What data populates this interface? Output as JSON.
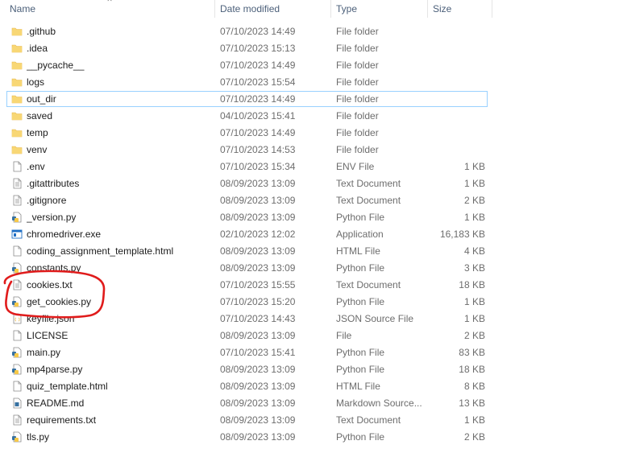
{
  "columns": {
    "name": "Name",
    "date": "Date modified",
    "type": "Type",
    "size": "Size"
  },
  "icon_colors": {
    "folder": "#f8d775",
    "folder_dark": "#e8b84a",
    "file_outline": "#8a8a8a",
    "python_blue": "#3771a1",
    "python_yellow": "#f7c948",
    "exe_blue": "#1f6fc5",
    "selection_border": "#99d1ff",
    "annotation_red": "#e01b1b"
  },
  "files": [
    {
      "name": ".github",
      "date": "07/10/2023 14:49",
      "type": "File folder",
      "size": "",
      "icon": "folder-icon"
    },
    {
      "name": ".idea",
      "date": "07/10/2023 15:13",
      "type": "File folder",
      "size": "",
      "icon": "folder-icon"
    },
    {
      "name": "__pycache__",
      "date": "07/10/2023 14:49",
      "type": "File folder",
      "size": "",
      "icon": "folder-icon"
    },
    {
      "name": "logs",
      "date": "07/10/2023 15:54",
      "type": "File folder",
      "size": "",
      "icon": "folder-icon"
    },
    {
      "name": "out_dir",
      "date": "07/10/2023 14:49",
      "type": "File folder",
      "size": "",
      "icon": "folder-icon",
      "selected": true
    },
    {
      "name": "saved",
      "date": "04/10/2023 15:41",
      "type": "File folder",
      "size": "",
      "icon": "folder-icon"
    },
    {
      "name": "temp",
      "date": "07/10/2023 14:49",
      "type": "File folder",
      "size": "",
      "icon": "folder-icon"
    },
    {
      "name": "venv",
      "date": "07/10/2023 14:53",
      "type": "File folder",
      "size": "",
      "icon": "folder-icon"
    },
    {
      "name": ".env",
      "date": "07/10/2023 15:34",
      "type": "ENV File",
      "size": "1 KB",
      "icon": "blank-file-icon"
    },
    {
      "name": ".gitattributes",
      "date": "08/09/2023 13:09",
      "type": "Text Document",
      "size": "1 KB",
      "icon": "text-file-icon"
    },
    {
      "name": ".gitignore",
      "date": "08/09/2023 13:09",
      "type": "Text Document",
      "size": "2 KB",
      "icon": "text-file-icon"
    },
    {
      "name": "_version.py",
      "date": "08/09/2023 13:09",
      "type": "Python File",
      "size": "1 KB",
      "icon": "python-file-icon"
    },
    {
      "name": "chromedriver.exe",
      "date": "02/10/2023 12:02",
      "type": "Application",
      "size": "16,183 KB",
      "icon": "application-icon"
    },
    {
      "name": "coding_assignment_template.html",
      "date": "08/09/2023 13:09",
      "type": "HTML File",
      "size": "4 KB",
      "icon": "blank-file-icon"
    },
    {
      "name": "constants.py",
      "date": "08/09/2023 13:09",
      "type": "Python File",
      "size": "3 KB",
      "icon": "python-file-icon"
    },
    {
      "name": "cookies.txt",
      "date": "07/10/2023 15:55",
      "type": "Text Document",
      "size": "18 KB",
      "icon": "text-file-icon"
    },
    {
      "name": "get_cookies.py",
      "date": "07/10/2023 15:20",
      "type": "Python File",
      "size": "1 KB",
      "icon": "python-file-icon"
    },
    {
      "name": "keyfile.json",
      "date": "07/10/2023 14:43",
      "type": "JSON Source File",
      "size": "1 KB",
      "icon": "json-file-icon"
    },
    {
      "name": "LICENSE",
      "date": "08/09/2023 13:09",
      "type": "File",
      "size": "2 KB",
      "icon": "blank-file-icon"
    },
    {
      "name": "main.py",
      "date": "07/10/2023 15:41",
      "type": "Python File",
      "size": "83 KB",
      "icon": "python-file-icon"
    },
    {
      "name": "mp4parse.py",
      "date": "08/09/2023 13:09",
      "type": "Python File",
      "size": "18 KB",
      "icon": "python-file-icon"
    },
    {
      "name": "quiz_template.html",
      "date": "08/09/2023 13:09",
      "type": "HTML File",
      "size": "8 KB",
      "icon": "blank-file-icon"
    },
    {
      "name": "README.md",
      "date": "08/09/2023 13:09",
      "type": "Markdown Source...",
      "size": "13 KB",
      "icon": "markdown-file-icon"
    },
    {
      "name": "requirements.txt",
      "date": "08/09/2023 13:09",
      "type": "Text Document",
      "size": "1 KB",
      "icon": "text-file-icon"
    },
    {
      "name": "tls.py",
      "date": "08/09/2023 13:09",
      "type": "Python File",
      "size": "2 KB",
      "icon": "python-file-icon"
    }
  ]
}
